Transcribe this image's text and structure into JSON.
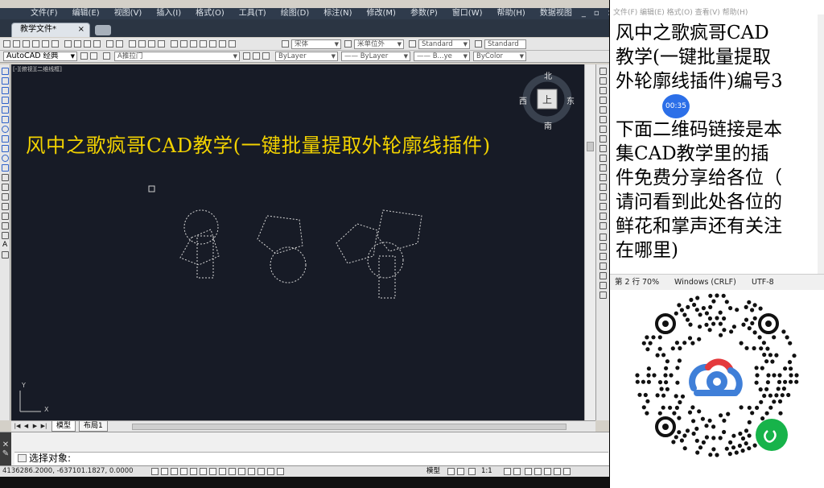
{
  "menu": {
    "items": [
      "文件(F)",
      "编辑(E)",
      "视图(V)",
      "插入(I)",
      "格式(O)",
      "工具(T)",
      "绘图(D)",
      "标注(N)",
      "修改(M)",
      "参数(P)",
      "窗口(W)",
      "帮助(H)",
      "数据视图"
    ],
    "min": "_",
    "restore": "▫",
    "close": "×"
  },
  "doc_tab": {
    "label": "教学文件*",
    "close": "×"
  },
  "toolbar": {
    "font_combo": "宋体",
    "unit_combo": "米单位外",
    "style1_combo": "Standard",
    "style2_combo": "Standard",
    "workspace_combo": "AutoCAD 经典",
    "layer_combo": "A推拉门",
    "color_combo": "ByLayer",
    "linetype_combo": "—— ByLayer",
    "lineweight_combo": "—— B...ye",
    "plotstyle_combo": "ByColor"
  },
  "viewport": {
    "label": "[-][俯视][二维线框]",
    "overlay_title": "风中之歌疯哥CAD教学(一键批量提取外轮廓线插件)",
    "viewcube": {
      "north": "北",
      "south": "南",
      "east": "东",
      "west": "西",
      "top": "上"
    },
    "ucs_x": "X",
    "ucs_y": "Y"
  },
  "layout_tabs": {
    "model": "模型",
    "layout": "布局1"
  },
  "command": {
    "prompt": "选择对象:"
  },
  "status": {
    "coords": "4136286.2000, -637101.1827, 0.0000",
    "model": "模型",
    "scale": "1:1"
  },
  "notepad": {
    "menu": "文件(F)  编辑(E)  格式(O)  查看(V)  帮助(H)",
    "lines1": [
      "风中之歌疯哥CAD",
      "教学(一键批量提取",
      "外轮廓线插件)编号3"
    ],
    "lines2": [
      "下面二维码链接是本",
      "集CAD教学里的插",
      "件免费分享给各位（",
      "请问看到此处各位的",
      "鲜花和掌声还有关注",
      "在哪里)"
    ],
    "timer": "00:35",
    "status_pos": "第 2 行",
    "status_zoom": "70%",
    "status_eol": "Windows (CRLF)",
    "status_enc": "UTF-8"
  },
  "colors": {
    "viewport_bg": "#171b26",
    "overlay_title": "#f2d200",
    "timer_bg": "#2c6fe8",
    "qr_blue": "#3f7fd8",
    "qr_red": "#e4393c",
    "miniprogram_green": "#17b34a"
  }
}
